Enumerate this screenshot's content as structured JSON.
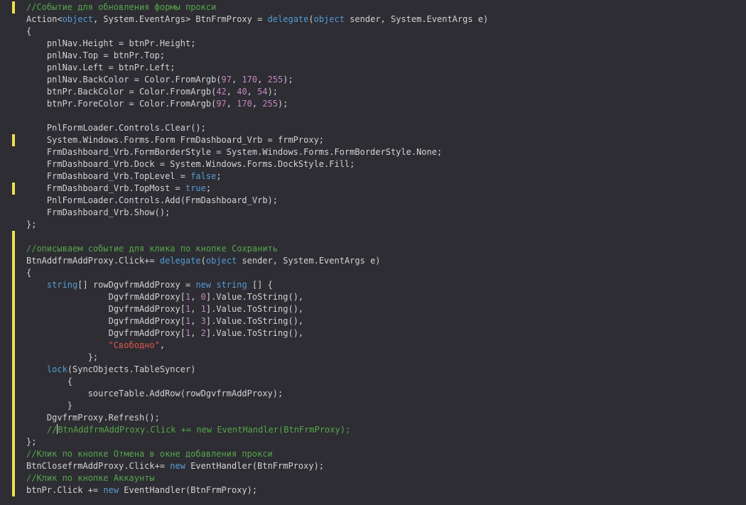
{
  "editor": {
    "language": "C#",
    "colors": {
      "background": "#2d2d33",
      "text": "#d4d4d4",
      "keyword": "#569cd6",
      "number": "#c586c0",
      "string": "#e0574f",
      "comment": "#57a64a",
      "change_marker": "#efe04a",
      "cursor": "#dcdcdc"
    },
    "lines": [
      {
        "mark": true,
        "tokens": [
          {
            "t": "c",
            "v": "//Событие для обновления формы прокси"
          }
        ]
      },
      {
        "mark": false,
        "tokens": [
          {
            "t": "p",
            "v": "Action<"
          },
          {
            "t": "k",
            "v": "object"
          },
          {
            "t": "p",
            "v": ", System.EventArgs> BtnFrmProxy = "
          },
          {
            "t": "k",
            "v": "delegate"
          },
          {
            "t": "p",
            "v": "("
          },
          {
            "t": "k",
            "v": "object"
          },
          {
            "t": "p",
            "v": " sender, System.EventArgs e)"
          }
        ]
      },
      {
        "mark": false,
        "tokens": [
          {
            "t": "p",
            "v": "{"
          }
        ]
      },
      {
        "mark": false,
        "tokens": [
          {
            "t": "p",
            "v": "    pnlNav.Height = btnPr.Height;"
          }
        ]
      },
      {
        "mark": false,
        "tokens": [
          {
            "t": "p",
            "v": "    pnlNav.Top = btnPr.Top;"
          }
        ]
      },
      {
        "mark": false,
        "tokens": [
          {
            "t": "p",
            "v": "    pnlNav.Left = btnPr.Left;"
          }
        ]
      },
      {
        "mark": false,
        "tokens": [
          {
            "t": "p",
            "v": "    pnlNav.BackColor = Color.FromArgb("
          },
          {
            "t": "n",
            "v": "97"
          },
          {
            "t": "p",
            "v": ", "
          },
          {
            "t": "n",
            "v": "170"
          },
          {
            "t": "p",
            "v": ", "
          },
          {
            "t": "n",
            "v": "255"
          },
          {
            "t": "p",
            "v": ");"
          }
        ]
      },
      {
        "mark": false,
        "tokens": [
          {
            "t": "p",
            "v": "    btnPr.BackColor = Color.FromArgb("
          },
          {
            "t": "n",
            "v": "42"
          },
          {
            "t": "p",
            "v": ", "
          },
          {
            "t": "n",
            "v": "40"
          },
          {
            "t": "p",
            "v": ", "
          },
          {
            "t": "n",
            "v": "54"
          },
          {
            "t": "p",
            "v": ");"
          }
        ]
      },
      {
        "mark": false,
        "tokens": [
          {
            "t": "p",
            "v": "    btnPr.ForeColor = Color.FromArgb("
          },
          {
            "t": "n",
            "v": "97"
          },
          {
            "t": "p",
            "v": ", "
          },
          {
            "t": "n",
            "v": "170"
          },
          {
            "t": "p",
            "v": ", "
          },
          {
            "t": "n",
            "v": "255"
          },
          {
            "t": "p",
            "v": ");"
          }
        ]
      },
      {
        "mark": false,
        "tokens": []
      },
      {
        "mark": false,
        "tokens": [
          {
            "t": "p",
            "v": "    PnlFormLoader.Controls.Clear();"
          }
        ]
      },
      {
        "mark": true,
        "tokens": [
          {
            "t": "p",
            "v": "    System.Windows.Forms.Form FrmDashboard_Vrb = frmProxy;"
          }
        ]
      },
      {
        "mark": false,
        "tokens": [
          {
            "t": "p",
            "v": "    FrmDashboard_Vrb.FormBorderStyle = System.Windows.Forms.FormBorderStyle.None;"
          }
        ]
      },
      {
        "mark": false,
        "tokens": [
          {
            "t": "p",
            "v": "    FrmDashboard_Vrb.Dock = System.Windows.Forms.DockStyle.Fill;"
          }
        ]
      },
      {
        "mark": false,
        "tokens": [
          {
            "t": "p",
            "v": "    FrmDashboard_Vrb.TopLevel = "
          },
          {
            "t": "k",
            "v": "false"
          },
          {
            "t": "p",
            "v": ";"
          }
        ]
      },
      {
        "mark": true,
        "tokens": [
          {
            "t": "p",
            "v": "    FrmDashboard_Vrb.TopMost = "
          },
          {
            "t": "k",
            "v": "true"
          },
          {
            "t": "p",
            "v": ";"
          }
        ]
      },
      {
        "mark": false,
        "tokens": [
          {
            "t": "p",
            "v": "    PnlFormLoader.Controls.Add(FrmDashboard_Vrb);"
          }
        ]
      },
      {
        "mark": false,
        "tokens": [
          {
            "t": "p",
            "v": "    FrmDashboard_Vrb.Show();"
          }
        ]
      },
      {
        "mark": false,
        "tokens": [
          {
            "t": "p",
            "v": "};"
          }
        ]
      },
      {
        "mark": true,
        "tokens": []
      },
      {
        "mark": true,
        "tokens": [
          {
            "t": "c",
            "v": "//описываем событие для клика по кнопке Сохранить"
          }
        ]
      },
      {
        "mark": true,
        "tokens": [
          {
            "t": "p",
            "v": "BtnAddfrmAddProxy.Click+= "
          },
          {
            "t": "k",
            "v": "delegate"
          },
          {
            "t": "p",
            "v": "("
          },
          {
            "t": "k",
            "v": "object"
          },
          {
            "t": "p",
            "v": " sender, System.EventArgs e)"
          }
        ]
      },
      {
        "mark": true,
        "tokens": [
          {
            "t": "p",
            "v": "{"
          }
        ]
      },
      {
        "mark": true,
        "tokens": [
          {
            "t": "p",
            "v": "    "
          },
          {
            "t": "k",
            "v": "string"
          },
          {
            "t": "p",
            "v": "[] rowDgvfrmAddProxy = "
          },
          {
            "t": "k",
            "v": "new"
          },
          {
            "t": "p",
            "v": " "
          },
          {
            "t": "k",
            "v": "string"
          },
          {
            "t": "p",
            "v": " [] {"
          }
        ]
      },
      {
        "mark": true,
        "tokens": [
          {
            "t": "p",
            "v": "                DgvfrmAddProxy["
          },
          {
            "t": "n",
            "v": "1"
          },
          {
            "t": "p",
            "v": ", "
          },
          {
            "t": "n",
            "v": "0"
          },
          {
            "t": "p",
            "v": "].Value.ToString(),"
          }
        ]
      },
      {
        "mark": true,
        "tokens": [
          {
            "t": "p",
            "v": "                DgvfrmAddProxy["
          },
          {
            "t": "n",
            "v": "1"
          },
          {
            "t": "p",
            "v": ", "
          },
          {
            "t": "n",
            "v": "1"
          },
          {
            "t": "p",
            "v": "].Value.ToString(),"
          }
        ]
      },
      {
        "mark": true,
        "tokens": [
          {
            "t": "p",
            "v": "                DgvfrmAddProxy["
          },
          {
            "t": "n",
            "v": "1"
          },
          {
            "t": "p",
            "v": ", "
          },
          {
            "t": "n",
            "v": "3"
          },
          {
            "t": "p",
            "v": "].Value.ToString(),"
          }
        ]
      },
      {
        "mark": true,
        "tokens": [
          {
            "t": "p",
            "v": "                DgvfrmAddProxy["
          },
          {
            "t": "n",
            "v": "1"
          },
          {
            "t": "p",
            "v": ", "
          },
          {
            "t": "n",
            "v": "2"
          },
          {
            "t": "p",
            "v": "].Value.ToString(),"
          }
        ]
      },
      {
        "mark": true,
        "tokens": [
          {
            "t": "p",
            "v": "                "
          },
          {
            "t": "s",
            "v": "\"Свободно\""
          },
          {
            "t": "p",
            "v": ","
          }
        ]
      },
      {
        "mark": true,
        "tokens": [
          {
            "t": "p",
            "v": "            };"
          }
        ]
      },
      {
        "mark": true,
        "tokens": [
          {
            "t": "p",
            "v": "    "
          },
          {
            "t": "k",
            "v": "lock"
          },
          {
            "t": "p",
            "v": "(SyncObjects.TableSyncer)"
          }
        ]
      },
      {
        "mark": true,
        "tokens": [
          {
            "t": "p",
            "v": "        {"
          }
        ]
      },
      {
        "mark": true,
        "tokens": [
          {
            "t": "p",
            "v": "            sourceTable.AddRow(rowDgvfrmAddProxy);"
          }
        ]
      },
      {
        "mark": true,
        "tokens": [
          {
            "t": "p",
            "v": "        }"
          }
        ]
      },
      {
        "mark": true,
        "tokens": [
          {
            "t": "p",
            "v": "    DgvfrmProxy.Refresh();"
          }
        ]
      },
      {
        "mark": true,
        "cursor_after": 0,
        "tokens": [
          {
            "t": "c",
            "v": "    //"
          },
          {
            "t": "c",
            "v": "BtnAddfrmAddProxy.Click += new EventHandler(BtnFrmProxy);"
          }
        ]
      },
      {
        "mark": true,
        "tokens": [
          {
            "t": "p",
            "v": "};"
          }
        ]
      },
      {
        "mark": true,
        "tokens": [
          {
            "t": "c",
            "v": "//Клик по кнопке Отмена в окне добавления прокси"
          }
        ]
      },
      {
        "mark": true,
        "tokens": [
          {
            "t": "p",
            "v": "BtnClosefrmAddProxy.Click+= "
          },
          {
            "t": "k",
            "v": "new"
          },
          {
            "t": "p",
            "v": " EventHandler(BtnFrmProxy);"
          }
        ]
      },
      {
        "mark": true,
        "tokens": [
          {
            "t": "c",
            "v": "//Клик по кнопке Аккаунты"
          }
        ]
      },
      {
        "mark": true,
        "tokens": [
          {
            "t": "p",
            "v": "btnPr.Click += "
          },
          {
            "t": "k",
            "v": "new"
          },
          {
            "t": "p",
            "v": " EventHandler(BtnFrmProxy);"
          }
        ]
      }
    ]
  }
}
